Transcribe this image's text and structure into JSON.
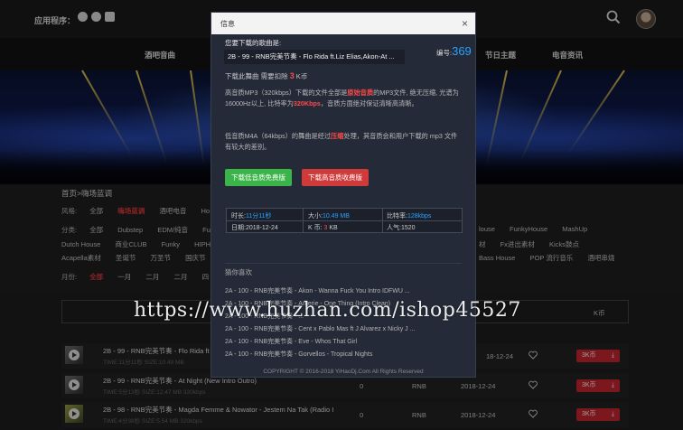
{
  "topbar": {
    "app_label": "应用程序：",
    "os_icons": [
      "android-icon",
      "windows-icon",
      "apple-icon"
    ]
  },
  "nav": {
    "items": [
      "酒吧音曲",
      "节日主题",
      "电音资讯"
    ]
  },
  "filters": {
    "breadcrumb_home": "首页",
    "breadcrumb_sep": ">",
    "breadcrumb_current": "嗨场蓝调",
    "style_label": "风格:",
    "style_items": [
      "全部",
      "嗨场蓝调",
      "酒吧电音",
      "Ho"
    ],
    "category_label": "分类:",
    "category_items_left": [
      "全部",
      "Dubstep",
      "EDM/纯音",
      "Fu"
    ],
    "category_items_right": [
      "louse",
      "FunkyHouse",
      "MashUp"
    ],
    "row3_left": [
      "Dutch House",
      "商业CLUB",
      "Funky",
      "HIPHC"
    ],
    "row3_right": [
      "材",
      "Fx进出素材",
      "Kicks鼓点"
    ],
    "row4_left": [
      "Acapella素材",
      "圣诞节",
      "万圣节",
      "国庆节"
    ],
    "row4_right": [
      "Bass House",
      "POP 流行音乐",
      "酒吧串烧"
    ],
    "month_label": "月份:",
    "month_items": [
      "全部",
      "一月",
      "二月",
      "二月",
      "四"
    ]
  },
  "table_header": {
    "right_col": "K币"
  },
  "tracks": [
    {
      "title": "2B - 99 - RNB完美节奏 - Flo Rida ft",
      "meta": "TIME:11分11秒   SIZE:10.49 MB",
      "count": "",
      "style": "",
      "date": "18-12-24",
      "price": "3K币"
    },
    {
      "title": "2B - 99 - RNB完美节奏 - At Night (New Intro Outro)",
      "meta": "TIME:5分13秒   SIZE:12.47 MB   320kbps",
      "count": "0",
      "style": "RNB",
      "date": "2018-12-24",
      "price": "3K币"
    },
    {
      "title": "2B - 98 - RNB完美节奏 - Magda Femme & Nowator - Jestem Na Tak (Radio I",
      "meta": "TIME:4分38秒   SIZE:5.54 MB   320kbps",
      "count": "0",
      "style": "RNB",
      "date": "2018-12-24",
      "price": "3K币"
    }
  ],
  "modal": {
    "title": "信息",
    "close": "×",
    "song_label": "您要下载的歌曲是:",
    "song_name": "2B - 99 - RNB完美节奏 - Flo Rida ft.Liz Elias,Akon-At ...",
    "id_label": "编号:",
    "id_value": "369",
    "deduct_prefix": "下载此舞曲  需要扣除",
    "deduct_amount": "3",
    "deduct_suffix": "K币",
    "para1_a": "高音质MP3（320kbps）下载的文件全部是",
    "para1_red1": "原始音质",
    "para1_b": "的MP3文件, 绝无压缩, 光谱为16000Hz以上, 比特率为",
    "para1_red2": "320Kbps",
    "para1_c": "，音质方面绝对保证清晰高清晰。",
    "para2_a": "低音质M4A（64kbps）的舞曲是经过",
    "para2_red": "压缩",
    "para2_b": "处理，其音质会和用户下载的 mp3 文件有较大的差别。",
    "btn_low": "下载低音质免费版",
    "btn_high": "下载高音质收费版",
    "info": {
      "duration_label": "时长:",
      "duration": "11分11秒",
      "size_label": "大小:",
      "size": "10.49 MB",
      "bitrate_label": "比特率:",
      "bitrate": "128kbps",
      "date_label": "日期:",
      "date": "2018-12-24",
      "kb_label": "K 币:",
      "kb": "3",
      "kb_unit": "KB",
      "pop_label": "人气:",
      "pop": "1520"
    },
    "rec_title": "猜你喜欢",
    "recommendations": [
      "2A - 100 - RNB完美节奏 - Akon - Wanna Fuck You Intro IDFWU ...",
      "2A - 100 - RNB完美节奏 - Amerie - One Thing (Intro Clean)",
      "2A - 100 - RNB完美节奏 - ...",
      "2A - 100 - RNB完美节奏 - Cent x Pablo Mas ft J Alvarez x Nicky J ...",
      "2A - 100 - RNB完美节奏 - Eve - Whos That Girl",
      "2A - 100 - RNB完美节奏 - Gorvellos - Tropical Nights"
    ],
    "copyright": "COPYRIGHT © 2016-2018 YiHaoDj.Com All Rights Reserved"
  },
  "watermark": "https://www.huzhan.com/ishop45527",
  "colors": {
    "accent_blue": "#29a3ff",
    "accent_red": "#c8262f",
    "btn_green": "#3bb44a"
  }
}
